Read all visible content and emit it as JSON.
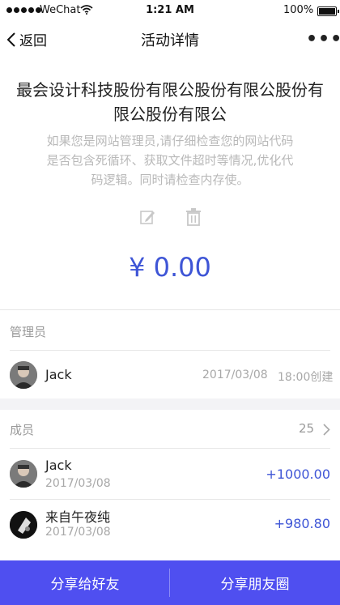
{
  "status_bar": {
    "carrier": "WeChat",
    "time": "1:21 AM",
    "battery": "100%"
  },
  "nav": {
    "back_label": "返回",
    "title": "活动详情",
    "more": "•••"
  },
  "activity": {
    "title": "最会设计科技股份有限公股份有限公股份有限公股份有限公",
    "description": "如果您是网站管理员,请仔细检查您的网站代码是否包含死循环、获取文件超时等情况,优化代码逻辑。同时请检查内存使。",
    "amount": "¥ 0.00"
  },
  "admin_section": {
    "label": "管理员",
    "admin": {
      "name": "Jack",
      "date": "2017/03/08",
      "time_note": "18:00创建"
    }
  },
  "members_section": {
    "label": "成员",
    "count": "25",
    "members": [
      {
        "name": "Jack",
        "date": "2017/03/08",
        "amount": "+1000.00"
      },
      {
        "name": "来自午夜纯",
        "date": "2017/03/08",
        "amount": "+980.80"
      }
    ]
  },
  "bottom_bar": {
    "share_friend": "分享给好友",
    "share_moments": "分享朋友圈"
  },
  "colors": {
    "accent": "#3e55d6",
    "bottom_bar": "#4f4ff0"
  }
}
